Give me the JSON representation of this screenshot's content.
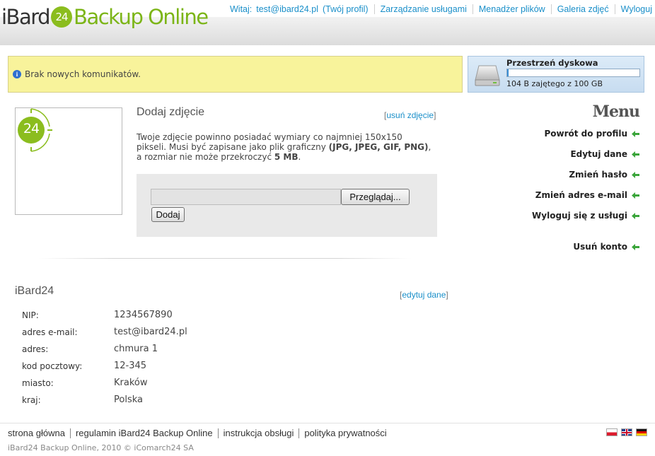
{
  "header": {
    "logo": {
      "prefix": "iBard",
      "badge": "24",
      "suffix": "Backup Online"
    },
    "greeting": "Witaj:",
    "user_email": "test@ibard24.pl",
    "profile_link": "(Twój profil)",
    "nav": [
      "Zarządzanie usługami",
      "Menadżer plików",
      "Galeria zdjęć",
      "Wyloguj"
    ]
  },
  "messages": {
    "text": "Brak nowych komunikatów."
  },
  "disk": {
    "title": "Przestrzeń dyskowa",
    "usage_text": "104 B zajętego z 100 GB",
    "used_fraction": 0.01
  },
  "avatar": {
    "badge": "24"
  },
  "photo": {
    "title": "Dodaj zdjęcie",
    "remove_link": "usuń zdjęcie",
    "desc_1": "Twoje zdjęcie powinno posiadać wymiary co najmniej 150x150 pikseli. Musi być zapisane jako plik graficzny ",
    "desc_formats": "(JPG, JPEG, GIF, PNG)",
    "desc_2": ", a rozmiar nie może przekroczyć ",
    "desc_size": "5 MB",
    "desc_3": ".",
    "file_value": "",
    "browse_label": "Przeglądaj...",
    "add_label": "Dodaj"
  },
  "menu": {
    "title": "Menu",
    "items": [
      "Powrót do profilu",
      "Edytuj dane",
      "Zmień hasło",
      "Zmień adres e-mail",
      "Wyloguj się z usługi",
      "Usuń konto"
    ]
  },
  "account": {
    "title": "iBard24",
    "edit_link": "edytuj dane",
    "rows": [
      {
        "label": "NIP:",
        "value": "1234567890"
      },
      {
        "label": "adres e-mail:",
        "value": "test@ibard24.pl"
      },
      {
        "label": "adres:",
        "value": "chmura 1"
      },
      {
        "label": "kod pocztowy:",
        "value": "12-345"
      },
      {
        "label": "miasto:",
        "value": "Kraków"
      },
      {
        "label": "kraj:",
        "value": "Polska"
      }
    ]
  },
  "footer": {
    "links": [
      "strona główna",
      "regulamin iBard24 Backup Online",
      "instrukcja obsługi",
      "polityka prywatności"
    ],
    "copyright": "iBard24 Backup Online, 2010 © iComarch24 SA",
    "flags": [
      "pl",
      "gb",
      "de"
    ]
  },
  "colors": {
    "link_blue": "#1a8fc9",
    "brand_green": "#7cb518",
    "message_yellow": "#f8f39b",
    "menu_arrow_green": "#3aa53a"
  }
}
